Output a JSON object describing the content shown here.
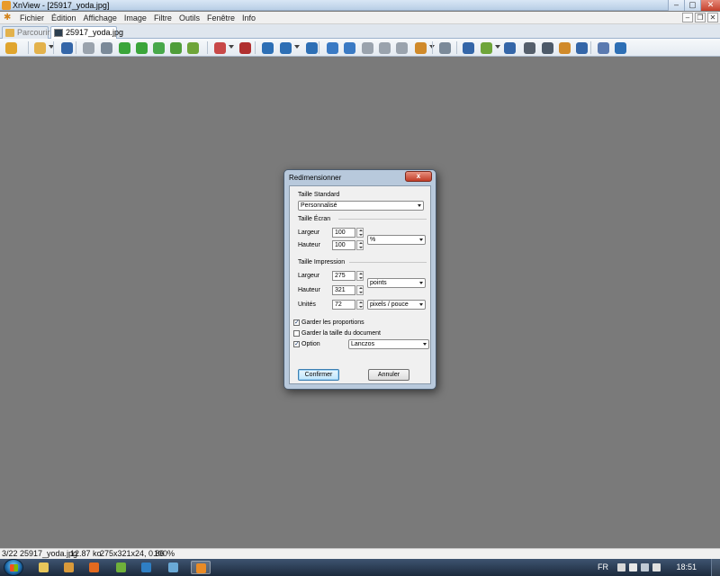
{
  "window": {
    "title": "XnView - [25917_yoda.jpg]",
    "controls": {
      "minimize": "–",
      "maximize": "▢",
      "close": "✕"
    }
  },
  "menu": {
    "items": [
      "Fichier",
      "Édition",
      "Affichage",
      "Image",
      "Filtre",
      "Outils",
      "Fenêtre",
      "Info"
    ],
    "mdi_controls": {
      "minimize": "–",
      "restore": "❐",
      "close": "✕"
    }
  },
  "tabs": [
    {
      "label": "Parcourir",
      "active": false
    },
    {
      "label": "25917_yoda.jpg",
      "active": true
    }
  ],
  "toolbar": {
    "buttons": [
      {
        "name": "browse-mode-icon",
        "color": "#e0a52e"
      },
      {
        "name": "open-folder-icon",
        "color": "#e3b24c"
      },
      {
        "name": "save-icon",
        "color": "#3466a8"
      },
      {
        "name": "print-preview-icon",
        "color": "#9aa3ad"
      },
      {
        "name": "crop-icon",
        "color": "#7b8a99"
      },
      {
        "name": "rotate-left-icon",
        "color": "#3aa53a"
      },
      {
        "name": "rotate-right-icon",
        "color": "#3aa53a"
      },
      {
        "name": "adjust-image-icon",
        "color": "#47a84a"
      },
      {
        "name": "enhance-icon",
        "color": "#4f9e3a"
      },
      {
        "name": "effects-icon",
        "color": "#6ea53a"
      },
      {
        "name": "colors-icon",
        "color": "#c84848"
      },
      {
        "name": "red-eye-icon",
        "color": "#b03030"
      },
      {
        "name": "zoom-in-icon",
        "color": "#2d6fb5"
      },
      {
        "name": "zoom-icon",
        "color": "#2d6fb5"
      },
      {
        "name": "zoom-out-icon",
        "color": "#2d6fb5"
      },
      {
        "name": "previous-icon",
        "color": "#3a7ac4"
      },
      {
        "name": "next-icon",
        "color": "#3a7ac4"
      },
      {
        "name": "first-page-icon",
        "color": "#9aa3ad"
      },
      {
        "name": "last-page-icon",
        "color": "#9aa3ad"
      },
      {
        "name": "copy-icon",
        "color": "#9aa3ad"
      },
      {
        "name": "slideshow-icon",
        "color": "#d08a2a"
      },
      {
        "name": "fit-window-icon",
        "color": "#7b8a99"
      },
      {
        "name": "fullscreen-icon",
        "color": "#3466a8"
      },
      {
        "name": "acquire-icon",
        "color": "#6ea53a"
      },
      {
        "name": "compare-icon",
        "color": "#3466a8"
      },
      {
        "name": "print-icon",
        "color": "#555f6b"
      },
      {
        "name": "scan-icon",
        "color": "#4d5a69"
      },
      {
        "name": "wallpaper-icon",
        "color": "#d08a2a"
      },
      {
        "name": "capture-icon",
        "color": "#3466a8"
      },
      {
        "name": "settings-icon",
        "color": "#5a7ab0"
      },
      {
        "name": "info-icon",
        "color": "#2d6fb5"
      }
    ]
  },
  "dialog": {
    "title": "Redimensionner",
    "close_label": "x",
    "standard_size": {
      "label": "Taille Standard",
      "value": "Personnalisé"
    },
    "screen_size": {
      "label": "Taille Écran",
      "width_label": "Largeur",
      "width_value": "100",
      "height_label": "Hauteur",
      "height_value": "100",
      "unit_value": "%"
    },
    "print_size": {
      "label": "Taille Impression",
      "width_label": "Largeur",
      "width_value": "275",
      "height_label": "Hauteur",
      "height_value": "321",
      "unit_value": "points",
      "resolution_label": "Unités",
      "resolution_value": "72",
      "resolution_unit_value": "pixels / pouce"
    },
    "keep_ratio": {
      "label": "Garder les proportions",
      "checked": true
    },
    "keep_doc_size": {
      "label": "Garder la taille du document",
      "checked": false
    },
    "option": {
      "label": "Option",
      "checked": true,
      "value": "Lanczos"
    },
    "confirm_label": "Confirmer",
    "cancel_label": "Annuler"
  },
  "status": {
    "index": "3/22",
    "filename": "25917_yoda.jpg",
    "filesize": "12.87 ko",
    "dimensions": "275x321x24, 0.86",
    "zoom": "100%"
  },
  "taskbar": {
    "apps": [
      {
        "name": "explorer-icon",
        "color": "#e7c65a",
        "active": false
      },
      {
        "name": "file-manager-icon",
        "color": "#d99a3a",
        "active": false
      },
      {
        "name": "firefox-icon",
        "color": "#e36a1f",
        "active": false
      },
      {
        "name": "browser-q-icon",
        "color": "#6fb03a",
        "active": false
      },
      {
        "name": "photoshop-icon",
        "color": "#2f7fc4",
        "active": false
      },
      {
        "name": "network-icon",
        "color": "#6aa9d6",
        "active": false
      },
      {
        "name": "xnview-icon",
        "color": "#e98b26",
        "active": true
      }
    ],
    "lang": "FR",
    "clock": "18:51"
  }
}
